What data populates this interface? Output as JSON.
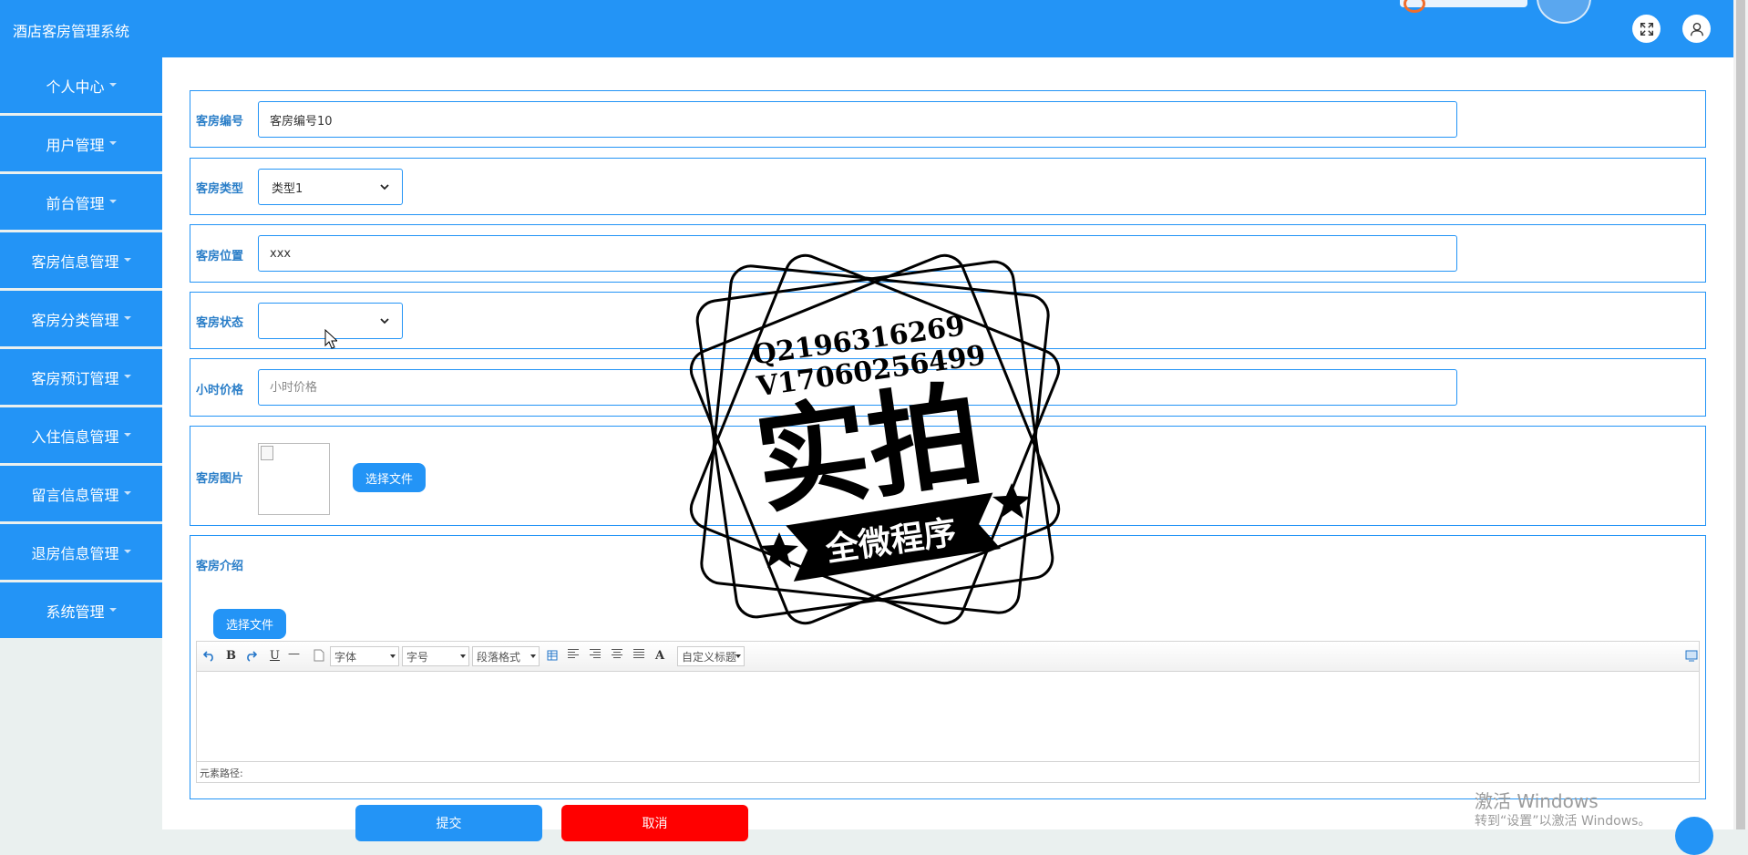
{
  "app": {
    "title": "酒店客房管理系统"
  },
  "header": {
    "fullscreen_icon": "expand-icon",
    "user_icon": "user-icon"
  },
  "sidebar": {
    "items": [
      {
        "label": "个人中心"
      },
      {
        "label": "用户管理"
      },
      {
        "label": "前台管理"
      },
      {
        "label": "客房信息管理"
      },
      {
        "label": "客房分类管理"
      },
      {
        "label": "客房预订管理"
      },
      {
        "label": "入住信息管理"
      },
      {
        "label": "留言信息管理"
      },
      {
        "label": "退房信息管理"
      },
      {
        "label": "系统管理"
      }
    ]
  },
  "form": {
    "room_number": {
      "label": "客房编号",
      "value": "客房编号10"
    },
    "room_type": {
      "label": "客房类型",
      "value": "类型1"
    },
    "room_location": {
      "label": "客房位置",
      "value": "xxx"
    },
    "room_status": {
      "label": "客房状态",
      "value": ""
    },
    "hourly_price": {
      "label": "小时价格",
      "placeholder": "小时价格"
    },
    "room_image": {
      "label": "客房图片",
      "button": "选择文件"
    },
    "room_intro": {
      "label": "客房介绍",
      "button": "选择文件"
    }
  },
  "editor": {
    "font_select": "字体",
    "size_select": "字号",
    "paragraph_select": "段落格式",
    "custom_title_select": "自定义标题",
    "status_text": "元素路径:"
  },
  "actions": {
    "submit": "提交",
    "cancel": "取消"
  },
  "watermark": {
    "line1": "Q2196316269",
    "line2": "V17060256499",
    "main": "实拍",
    "ribbon": "全微程序"
  },
  "os_notice": {
    "title": "激活 Windows",
    "subtitle": "转到“设置”以激活 Windows。"
  },
  "colors": {
    "primary": "#2394f6",
    "danger": "#ff0000",
    "sidebar_bg": "#eaf0ef"
  }
}
